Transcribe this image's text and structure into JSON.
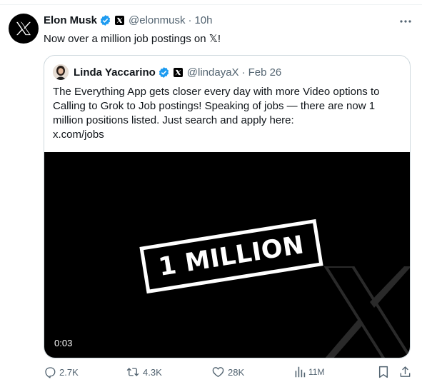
{
  "tweet": {
    "author_name": "Elon Musk",
    "author_handle": "@elonmusk",
    "separator": "·",
    "time": "10h",
    "text": "Now over a million job postings on 𝕏!"
  },
  "quoted": {
    "author_name": "Linda Yaccarino",
    "author_handle": "@lindayaX",
    "separator": "·",
    "date": "Feb 26",
    "text_lines": [
      "The Everything App gets closer every day with more Video options to",
      "Calling to Grok to Job postings! Speaking of jobs — there are now 1",
      "million positions listed. Just search and apply here:",
      "x.com/jobs"
    ],
    "video": {
      "headline": "1 MILLION",
      "duration": "0:03"
    }
  },
  "actions": {
    "replies": "2.7K",
    "reposts": "4.3K",
    "likes": "28K",
    "views": "11M"
  },
  "icons": {
    "avatar": "x-logo-icon",
    "verified": "verified-badge-icon",
    "affiliate": "x-affiliate-badge-icon",
    "more": "more-dots-icon",
    "reply": "reply-icon",
    "repost": "repost-icon",
    "like": "heart-icon",
    "views": "views-chart-icon",
    "bookmark": "bookmark-icon",
    "share": "share-icon"
  },
  "colors": {
    "verified_blue": "#1d9bf0",
    "muted_text": "#536471",
    "border": "#cfd9de"
  }
}
